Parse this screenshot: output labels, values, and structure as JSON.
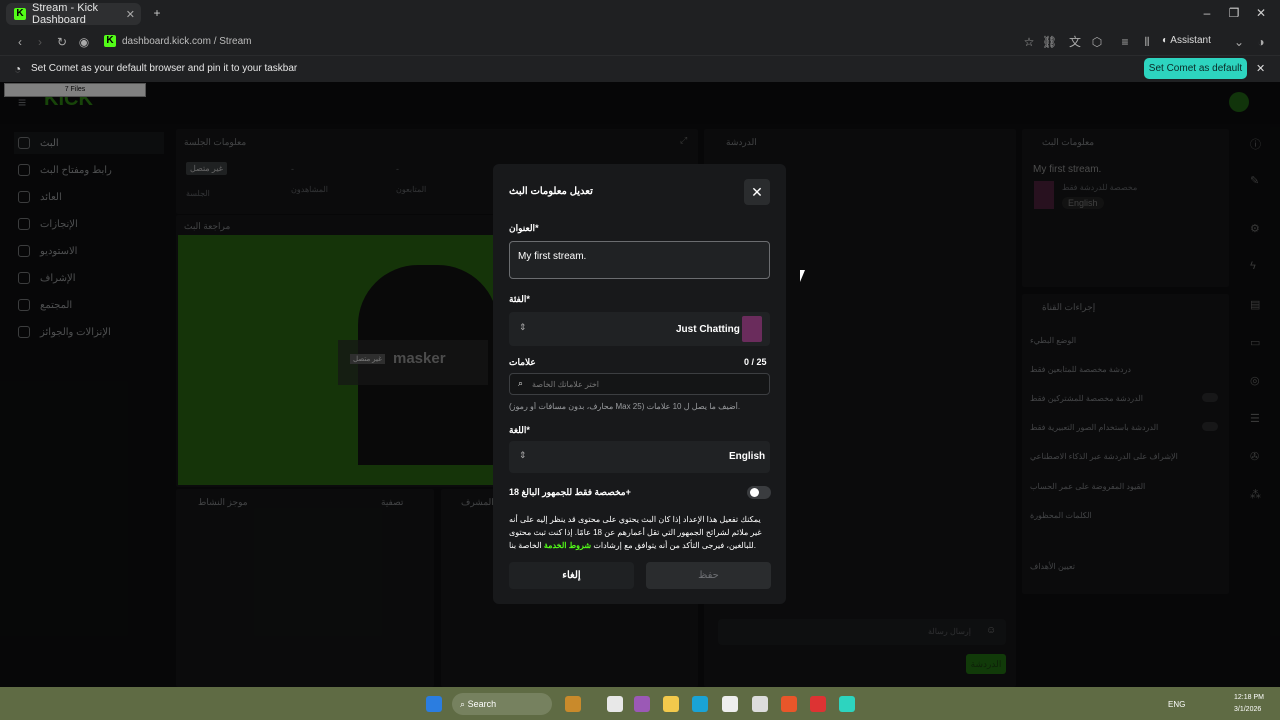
{
  "browser": {
    "tab_title": "Stream - Kick Dashboard",
    "url": "dashboard.kick.com / Stream",
    "assistant_label": "Assistant",
    "infobar_message": "Set Comet as your default browser and pin it to your taskbar",
    "infobar_button": "Set Comet as default",
    "files_badge": "7 Files"
  },
  "sidebar": {
    "items": [
      {
        "label": "البث",
        "active": true
      },
      {
        "label": "رابط ومفتاح البث"
      },
      {
        "label": "العائد"
      },
      {
        "label": "الإنجازات"
      },
      {
        "label": "الاستوديو"
      },
      {
        "label": "الإشراف"
      },
      {
        "label": "المجتمع"
      },
      {
        "label": "الإنزالات والجوائز"
      }
    ]
  },
  "panels": {
    "session_title": "معلومات الجلسة",
    "session_badge": "غير متصل",
    "session_fields": [
      "الجلسة",
      "المشاهدون",
      "المتابعون"
    ],
    "session_values": [
      "-",
      "-"
    ],
    "preview_title": "مراجعة البث",
    "preview_offline": "غير متصل",
    "preview_name": "masker",
    "activity_title": "موجز النشاط",
    "filter_label": "تصفية",
    "mod_title": "المشرف",
    "chat_title": "الدردشة",
    "chat_placeholder": "إرسال رسالة",
    "chat_button": "الدردشة",
    "info_title": "معلومات البث",
    "info_stream_title": "My first stream.",
    "info_sub": "مخصصة للدردشة فقط",
    "info_lang": "English",
    "actions_title": "إجراءات القناة",
    "actions": [
      "الوضع البطيء",
      "دردشة مخصصة للمتابعين فقط",
      "الدردشة مخصصة للمشتركين فقط",
      "الدردشة باستخدام الصور التعبيرية فقط",
      "الإشراف على الدردشة عبر الذكاء الاصطناعي",
      "القيود المفروضة على عمر الحساب",
      "الكلمات المحظورة",
      "تعيين الأهداف"
    ],
    "blocked_terms_small": "الكلمات المحظورة"
  },
  "modal": {
    "title": "تعديل معلومات البث",
    "title_label": "العنوان*",
    "title_value": "My first stream.",
    "category_label": "الفئة*",
    "category_value": "Just Chatting",
    "tags_label": "علامات",
    "tags_count": "0 / 25",
    "tags_placeholder": "اختر علاماتك الخاصة",
    "tags_hint": "(محارف، بدون مسافات أو رموز Max 25) أضيف ما يصل ل 10 علامات.",
    "language_label": "اللغة*",
    "language_value": "English",
    "mature_label": "مخصصة فقط للجمهور البالغ 18+",
    "mature_desc": "يمكنك تفعيل هذا الإعداد إذا كان البث يحتوي على محتوى قد ينظر إليه على أنه غير ملائم لشرائح الجمهور التي تقل أعمارهم عن 18 عامًا. إذا كنت تبث محتوى للبالغين، فيرجى التأكد من أنه يتوافق مع إرشادات",
    "mature_link": "شروط الخدمة",
    "mature_tail": "الخاصة بنا.",
    "save_button": "حفظ",
    "cancel_button": "إلغاء"
  },
  "taskbar": {
    "search_label": "Search",
    "lang": "ENG",
    "time": "12:18 PM",
    "date": "3/1/2026"
  }
}
